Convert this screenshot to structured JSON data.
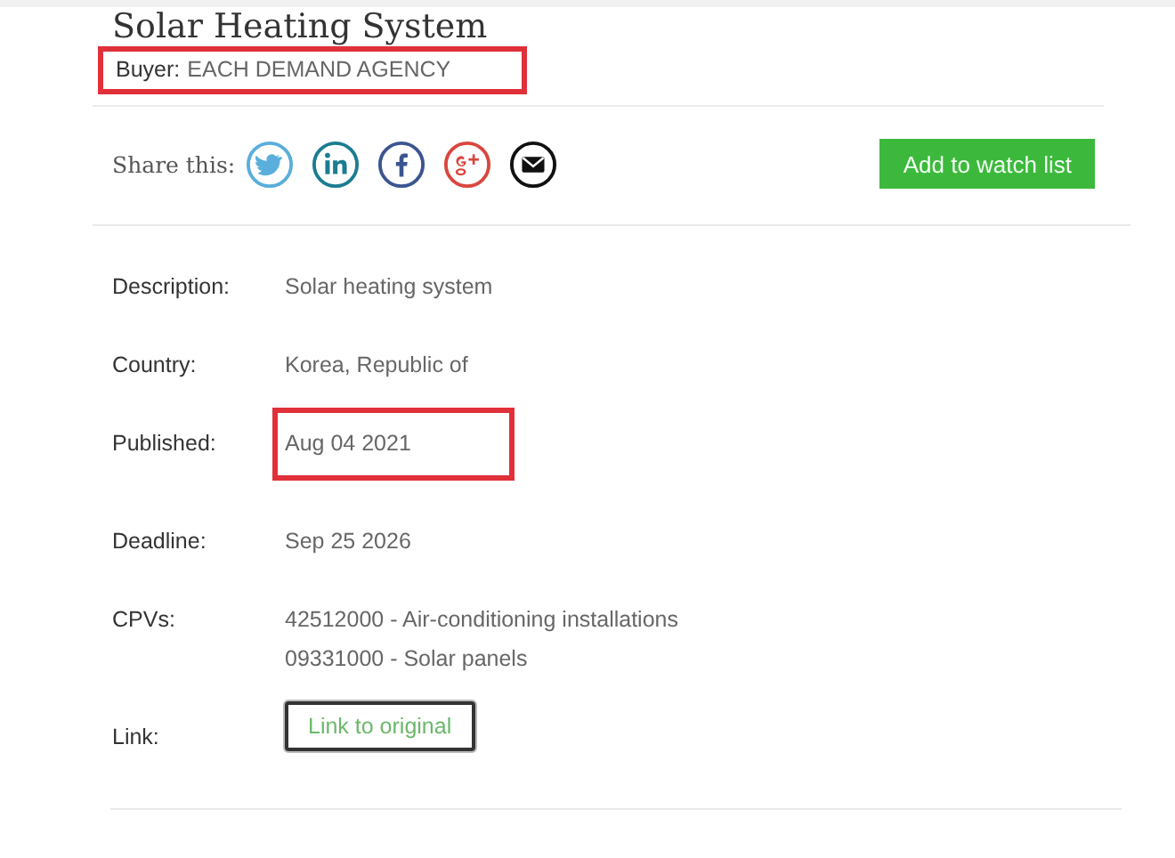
{
  "title": "Solar Heating System",
  "buyer": {
    "label": "Buyer:",
    "value": "EACH DEMAND AGENCY",
    "highlighted": true
  },
  "share": {
    "label": "Share this:",
    "icons": [
      {
        "kind": "twitter"
      },
      {
        "kind": "linkedin"
      },
      {
        "kind": "facebook"
      },
      {
        "kind": "googleplus"
      },
      {
        "kind": "email"
      }
    ]
  },
  "watch_button": "Add to watch list",
  "details": [
    {
      "kind": "text",
      "label": "Description:",
      "values": [
        "Solar heating system"
      ],
      "highlighted": false
    },
    {
      "kind": "text",
      "label": "Country:",
      "values": [
        "Korea, Republic of"
      ],
      "highlighted": false
    },
    {
      "kind": "text",
      "label": "Published:",
      "values": [
        "Aug 04 2021"
      ],
      "highlighted": true
    },
    {
      "kind": "text",
      "label": "Deadline:",
      "values": [
        "Sep 25 2026"
      ],
      "highlighted": false
    },
    {
      "kind": "text",
      "label": "CPVs:",
      "values": [
        "42512000 - Air-conditioning installations",
        "09331000 - Solar panels"
      ],
      "highlighted": false
    },
    {
      "kind": "link",
      "label": "Link:",
      "values": [
        "Link to original"
      ],
      "highlighted": false
    }
  ]
}
